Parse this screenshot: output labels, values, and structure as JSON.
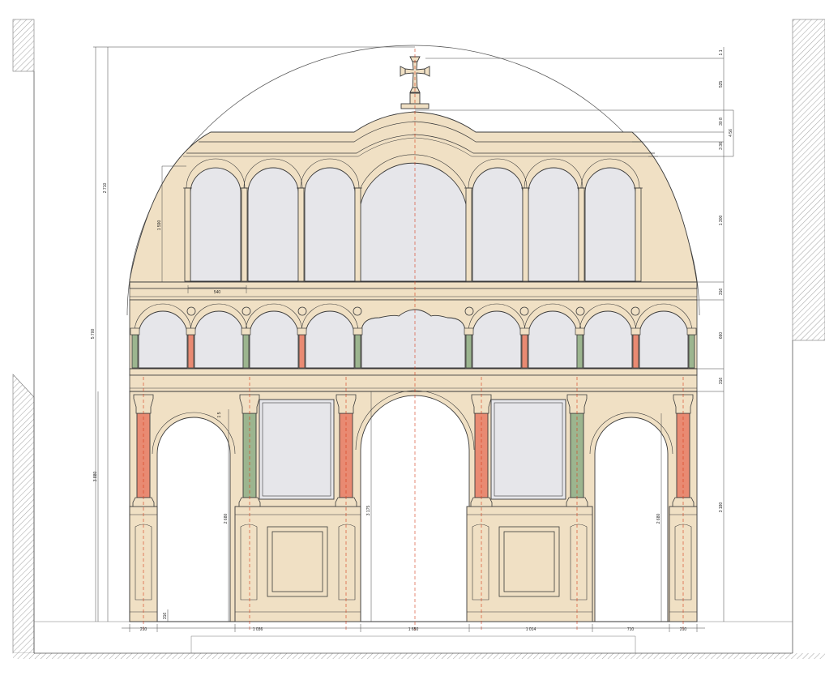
{
  "drawing": {
    "type": "iconostasis-elevation",
    "symbol": "cross-icon",
    "colors": {
      "wall": "#f0e0c4",
      "panel": "#e6e6ea",
      "column_red": "#e98a72",
      "column_green": "#9cb58f",
      "line": "#3a3a3a",
      "axis": "#d63a1a",
      "hatch": "#9a9a9a"
    }
  },
  "dimensions": {
    "bottom": [
      "210",
      "1 036",
      "1 650",
      "1 014",
      "710",
      "210"
    ],
    "right": [
      "1 1",
      "525",
      "30 8",
      "4 56",
      "3 36",
      "1 300",
      "316",
      "660",
      "316",
      "3 180"
    ],
    "left": [
      "2 710",
      "1 590",
      "5 700",
      "3 880",
      "316",
      "2 680",
      "3 175",
      "2 680"
    ],
    "inner": [
      "540",
      "1 5"
    ]
  }
}
